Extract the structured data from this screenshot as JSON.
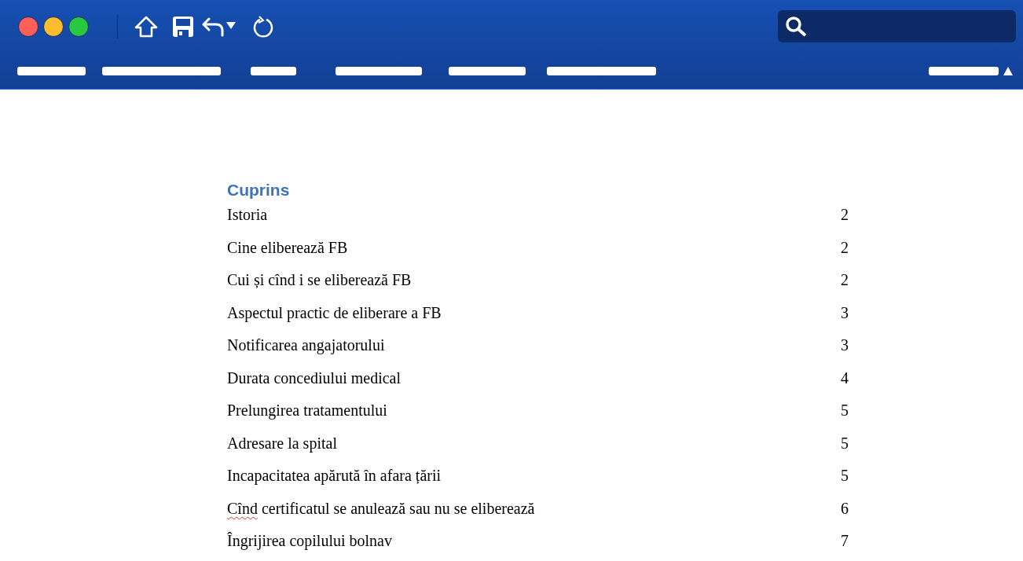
{
  "toc": {
    "heading": "Cuprins",
    "entries": [
      {
        "title": [
          {
            "text": "Istoria",
            "misspelled": false
          }
        ],
        "page": "2"
      },
      {
        "title": [
          {
            "text": "Cine eliberează FB",
            "misspelled": false
          }
        ],
        "page": "2"
      },
      {
        "title": [
          {
            "text": "Cui și cînd i se eliberează FB",
            "misspelled": false
          }
        ],
        "page": "2"
      },
      {
        "title": [
          {
            "text": "Aspectul practic de eliberare a FB",
            "misspelled": false
          }
        ],
        "page": "3"
      },
      {
        "title": [
          {
            "text": "Notificarea angajatorului",
            "misspelled": false
          }
        ],
        "page": "3"
      },
      {
        "title": [
          {
            "text": "Durata concediului medical",
            "misspelled": false
          }
        ],
        "page": "4"
      },
      {
        "title": [
          {
            "text": "Prelungirea tratamentului",
            "misspelled": false
          }
        ],
        "page": "5"
      },
      {
        "title": [
          {
            "text": "Adresare la spital",
            "misspelled": false
          }
        ],
        "page": "5"
      },
      {
        "title": [
          {
            "text": "Incapacitatea apărută în afara țării",
            "misspelled": false
          }
        ],
        "page": "5"
      },
      {
        "title": [
          {
            "text": "Cînd",
            "misspelled": true
          },
          {
            "text": " certificatul se anulează sau nu se eliberează",
            "misspelled": false
          }
        ],
        "page": "6"
      },
      {
        "title": [
          {
            "text": "Îngrijirea copilului bolnav",
            "misspelled": false
          }
        ],
        "page": "7"
      }
    ]
  }
}
